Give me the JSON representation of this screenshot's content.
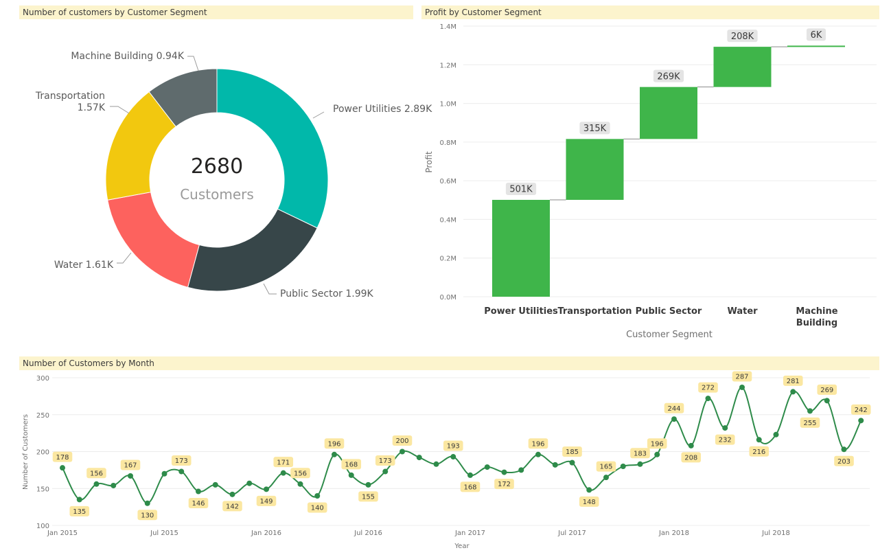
{
  "panels": {
    "donut_title": "Number of customers by Customer Segment",
    "waterfall_title": "Profit by Customer Segment",
    "line_title": "Number of Customers by Month"
  },
  "colors": {
    "title_bg": "#fcf4cd",
    "bar_green": "#3fb54a",
    "line_green": "#2e8b4a",
    "label_bg": "#fbe7a1",
    "wf_label_bg": "#e4e4e4"
  },
  "chart_data": [
    {
      "type": "pie",
      "subtype": "donut",
      "center_value": "2680",
      "center_label": "Customers",
      "slices": [
        {
          "name": "Power Utilities",
          "value": 2.89,
          "label": "Power Utilities 2.89K",
          "color": "#01b8aa"
        },
        {
          "name": "Public Sector",
          "value": 1.99,
          "label": "Public Sector 1.99K",
          "color": "#374649"
        },
        {
          "name": "Water",
          "value": 1.61,
          "label": "Water 1.61K",
          "color": "#fd625e"
        },
        {
          "name": "Transportation",
          "value": 1.57,
          "label": "Transportation 1.57K",
          "color": "#f2c80f"
        },
        {
          "name": "Machine Building",
          "value": 0.94,
          "label": "Machine Building 0.94K",
          "color": "#5f6b6d"
        }
      ]
    },
    {
      "type": "bar",
      "subtype": "waterfall",
      "categories": [
        "Power Utilities",
        "Transportation",
        "Public Sector",
        "Water",
        "Machine Building"
      ],
      "values": [
        501,
        315,
        269,
        208,
        6
      ],
      "value_labels": [
        "501K",
        "315K",
        "269K",
        "208K",
        "6K"
      ],
      "ylabel": "Profit",
      "xlabel": "Customer Segment",
      "yticks": [
        "0.0M",
        "0.2M",
        "0.4M",
        "0.6M",
        "0.8M",
        "1.0M",
        "1.2M",
        "1.4M"
      ],
      "ylim": [
        0,
        1.4
      ],
      "grid": true
    },
    {
      "type": "line",
      "xlabel": "Year",
      "ylabel": "Number of Customers",
      "ylim": [
        100,
        300
      ],
      "yticks": [
        "100",
        "150",
        "200",
        "250",
        "300"
      ],
      "xticks": [
        "Jan 2015",
        "Jul 2015",
        "Jan 2016",
        "Jul 2016",
        "Jan 2017",
        "Jul 2017",
        "Jan 2018",
        "Jul 2018"
      ],
      "grid": true,
      "x_start": "2015-01",
      "values": [
        178,
        135,
        156,
        154,
        167,
        130,
        170,
        173,
        146,
        155,
        142,
        157,
        149,
        171,
        156,
        140,
        196,
        168,
        155,
        173,
        200,
        192,
        183,
        193,
        168,
        179,
        172,
        175,
        196,
        182,
        185,
        148,
        165,
        180,
        183,
        196,
        244,
        208,
        272,
        232,
        287,
        216,
        223,
        281,
        255,
        269,
        203,
        242
      ],
      "labels": [
        {
          "i": 0,
          "t": "178"
        },
        {
          "i": 1,
          "t": "135"
        },
        {
          "i": 2,
          "t": "156"
        },
        {
          "i": 4,
          "t": "167"
        },
        {
          "i": 5,
          "t": "130"
        },
        {
          "i": 7,
          "t": "173"
        },
        {
          "i": 8,
          "t": "146"
        },
        {
          "i": 10,
          "t": "142"
        },
        {
          "i": 12,
          "t": "149"
        },
        {
          "i": 13,
          "t": "171"
        },
        {
          "i": 14,
          "t": "156"
        },
        {
          "i": 15,
          "t": "140"
        },
        {
          "i": 16,
          "t": "196"
        },
        {
          "i": 17,
          "t": "168"
        },
        {
          "i": 18,
          "t": "155"
        },
        {
          "i": 19,
          "t": "173"
        },
        {
          "i": 20,
          "t": "200"
        },
        {
          "i": 23,
          "t": "193"
        },
        {
          "i": 24,
          "t": "168"
        },
        {
          "i": 26,
          "t": "172"
        },
        {
          "i": 28,
          "t": "196"
        },
        {
          "i": 30,
          "t": "185"
        },
        {
          "i": 31,
          "t": "148"
        },
        {
          "i": 32,
          "t": "165"
        },
        {
          "i": 34,
          "t": "183"
        },
        {
          "i": 35,
          "t": "196"
        },
        {
          "i": 36,
          "t": "244"
        },
        {
          "i": 37,
          "t": "208"
        },
        {
          "i": 38,
          "t": "272"
        },
        {
          "i": 39,
          "t": "232"
        },
        {
          "i": 40,
          "t": "287"
        },
        {
          "i": 41,
          "t": "216"
        },
        {
          "i": 43,
          "t": "281"
        },
        {
          "i": 44,
          "t": "255"
        },
        {
          "i": 45,
          "t": "269"
        },
        {
          "i": 46,
          "t": "203"
        },
        {
          "i": 47,
          "t": "242"
        }
      ]
    }
  ]
}
